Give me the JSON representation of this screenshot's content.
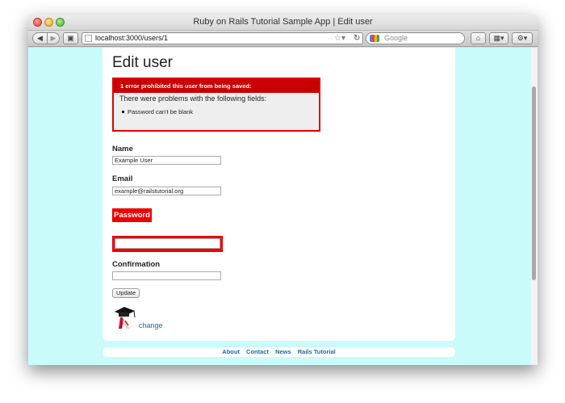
{
  "window": {
    "title": "Ruby on Rails Tutorial Sample App | Edit user"
  },
  "toolbar": {
    "url": "localhost:3000/users/1",
    "search_placeholder": "Google"
  },
  "page": {
    "heading": "Edit user",
    "error_box": {
      "header": "1 error prohibited this user from being saved:",
      "subheading": "There were problems with the following fields:",
      "items": [
        "Password can't be blank"
      ]
    },
    "fields": {
      "name": {
        "label": "Name",
        "value": "Example User"
      },
      "email": {
        "label": "Email",
        "value": "example@railstutorial.org"
      },
      "password": {
        "label": "Password",
        "value": ""
      },
      "confirmation": {
        "label": "Confirmation",
        "value": ""
      }
    },
    "submit_label": "Update",
    "change_link": "change"
  },
  "footer": {
    "links": [
      "About",
      "Contact",
      "News",
      "Rails Tutorial"
    ]
  },
  "colors": {
    "page_bg": "#c9fbfb",
    "error_red": "#ee0000",
    "error_header": "#c80000",
    "link": "#1a6aa9"
  }
}
